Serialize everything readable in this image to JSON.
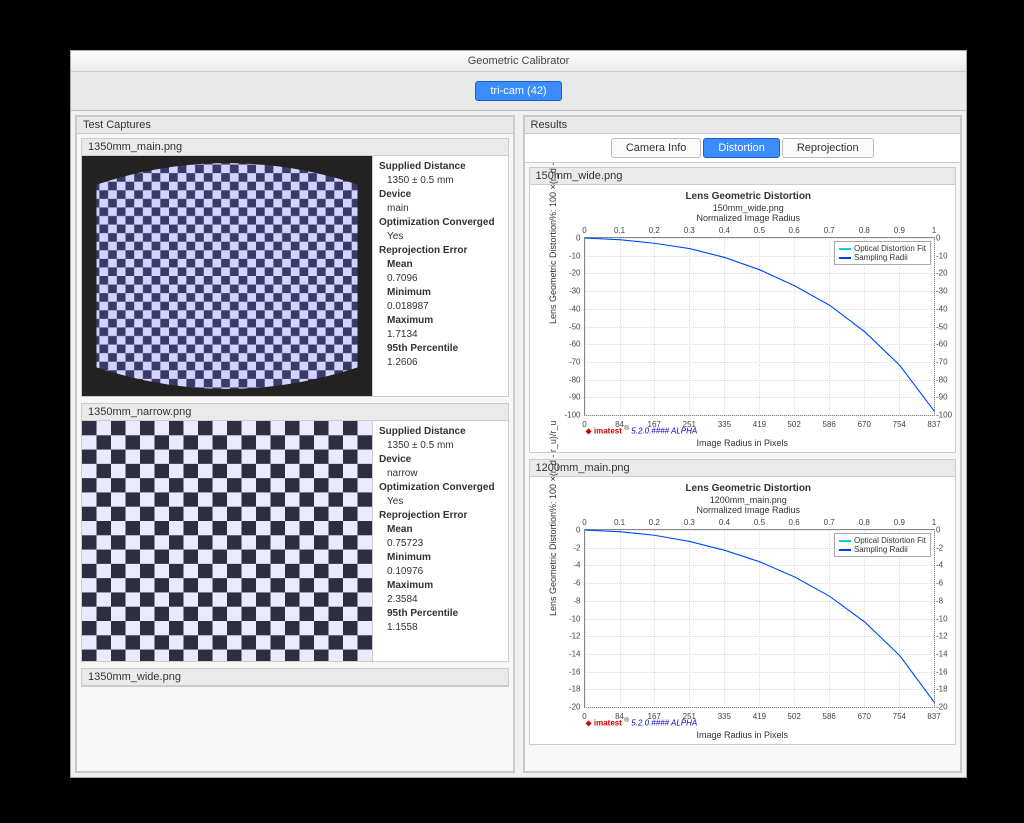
{
  "window": {
    "title": "Geometric Calibrator"
  },
  "toolbar": {
    "session_label": "tri-cam (42)"
  },
  "left_pane": {
    "title": "Test Captures",
    "captures": [
      {
        "filename": "1350mm_main.png",
        "supplied_distance_label": "Supplied Distance",
        "supplied_distance": "1350 ± 0.5 mm",
        "device_label": "Device",
        "device": "main",
        "opt_label": "Optimization Converged",
        "opt_value": "Yes",
        "repro_label": "Reprojection Error",
        "mean_label": "Mean",
        "mean": "0.7096",
        "min_label": "Minimum",
        "min": "0.018987",
        "max_label": "Maximum",
        "max": "1.7134",
        "p95_label": "95th Percentile",
        "p95": "1.2606"
      },
      {
        "filename": "1350mm_narrow.png",
        "supplied_distance_label": "Supplied Distance",
        "supplied_distance": "1350 ± 0.5 mm",
        "device_label": "Device",
        "device": "narrow",
        "opt_label": "Optimization Converged",
        "opt_value": "Yes",
        "repro_label": "Reprojection Error",
        "mean_label": "Mean",
        "mean": "0.75723",
        "min_label": "Minimum",
        "min": "0.10976",
        "max_label": "Maximum",
        "max": "2.3584",
        "p95_label": "95th Percentile",
        "p95": "1.1558"
      },
      {
        "filename": "1350mm_wide.png"
      }
    ]
  },
  "right_pane": {
    "title": "Results",
    "tabs": {
      "camera_info": "Camera Info",
      "distortion": "Distortion",
      "reprojection": "Reprojection"
    },
    "active_tab": "distortion",
    "plots": [
      {
        "filename": "150mm_wide.png"
      },
      {
        "filename": "1200mm_main.png"
      }
    ]
  },
  "chart_common": {
    "title": "Lens Geometric Distortion",
    "sub2": "Normalized Image Radius",
    "xlabel": "Image Radius in Pixels",
    "ylabel": "Lens Geometric Distortion%: 100 ×(r_d - r_u)/r_u",
    "legend": [
      "Optical Distortion Fit",
      "Sampling Radii"
    ],
    "brand": {
      "name": "imatest",
      "version": "5.2.0.#### ALPHA"
    }
  },
  "chart_data": [
    {
      "type": "line",
      "title": "Lens Geometric Distortion",
      "subtitle": "150mm_wide.png",
      "xlabel": "Image Radius in Pixels",
      "ylabel": "Lens Geometric Distortion%: 100 ×(r_d - r_u)/r_u",
      "x_top_ticks": [
        0,
        0.1,
        0.2,
        0.3,
        0.4,
        0.5,
        0.6,
        0.7,
        0.8,
        0.9,
        1
      ],
      "x_ticks": [
        0,
        84,
        167,
        251,
        335,
        419,
        502,
        586,
        670,
        754,
        837
      ],
      "y_ticks": [
        0,
        -10,
        -20,
        -30,
        -40,
        -50,
        -60,
        -70,
        -80,
        -90,
        -100
      ],
      "xlim": [
        0,
        837
      ],
      "ylim": [
        -100,
        0
      ],
      "series": [
        {
          "name": "Optical Distortion Fit",
          "color": "#00d0e0",
          "x": [
            0,
            84,
            167,
            251,
            335,
            419,
            502,
            586,
            670,
            754,
            837
          ],
          "y": [
            0,
            -1,
            -3,
            -6,
            -11,
            -18,
            -27,
            -38,
            -53,
            -72,
            -98
          ]
        },
        {
          "name": "Sampling Radii",
          "color": "#0040ff",
          "x": [
            0,
            84,
            167,
            251,
            335,
            419,
            502,
            586,
            670,
            754,
            837
          ],
          "y": [
            0,
            -1,
            -3,
            -6,
            -11,
            -18,
            -27,
            -38,
            -53,
            -72,
            -98
          ]
        }
      ]
    },
    {
      "type": "line",
      "title": "Lens Geometric Distortion",
      "subtitle": "1200mm_main.png",
      "xlabel": "Image Radius in Pixels",
      "ylabel": "Lens Geometric Distortion%: 100 ×(r_d - r_u)/r_u",
      "x_top_ticks": [
        0,
        0.1,
        0.2,
        0.3,
        0.4,
        0.5,
        0.6,
        0.7,
        0.8,
        0.9,
        1
      ],
      "x_ticks": [
        0,
        84,
        167,
        251,
        335,
        419,
        502,
        586,
        670,
        754,
        837
      ],
      "y_ticks": [
        0,
        -2,
        -4,
        -6,
        -8,
        -10,
        -12,
        -14,
        -16,
        -18,
        -20
      ],
      "xlim": [
        0,
        837
      ],
      "ylim": [
        -20,
        0
      ],
      "series": [
        {
          "name": "Optical Distortion Fit",
          "color": "#00d0e0",
          "x": [
            0,
            84,
            167,
            251,
            335,
            419,
            502,
            586,
            670,
            754,
            837
          ],
          "y": [
            0,
            -0.2,
            -0.6,
            -1.3,
            -2.3,
            -3.6,
            -5.3,
            -7.5,
            -10.4,
            -14.2,
            -19.5
          ]
        },
        {
          "name": "Sampling Radii",
          "color": "#0040ff",
          "x": [
            0,
            84,
            167,
            251,
            335,
            419,
            502,
            586,
            670,
            754,
            837
          ],
          "y": [
            0,
            -0.2,
            -0.6,
            -1.3,
            -2.3,
            -3.6,
            -5.3,
            -7.5,
            -10.4,
            -14.2,
            -19.5
          ]
        }
      ]
    }
  ]
}
